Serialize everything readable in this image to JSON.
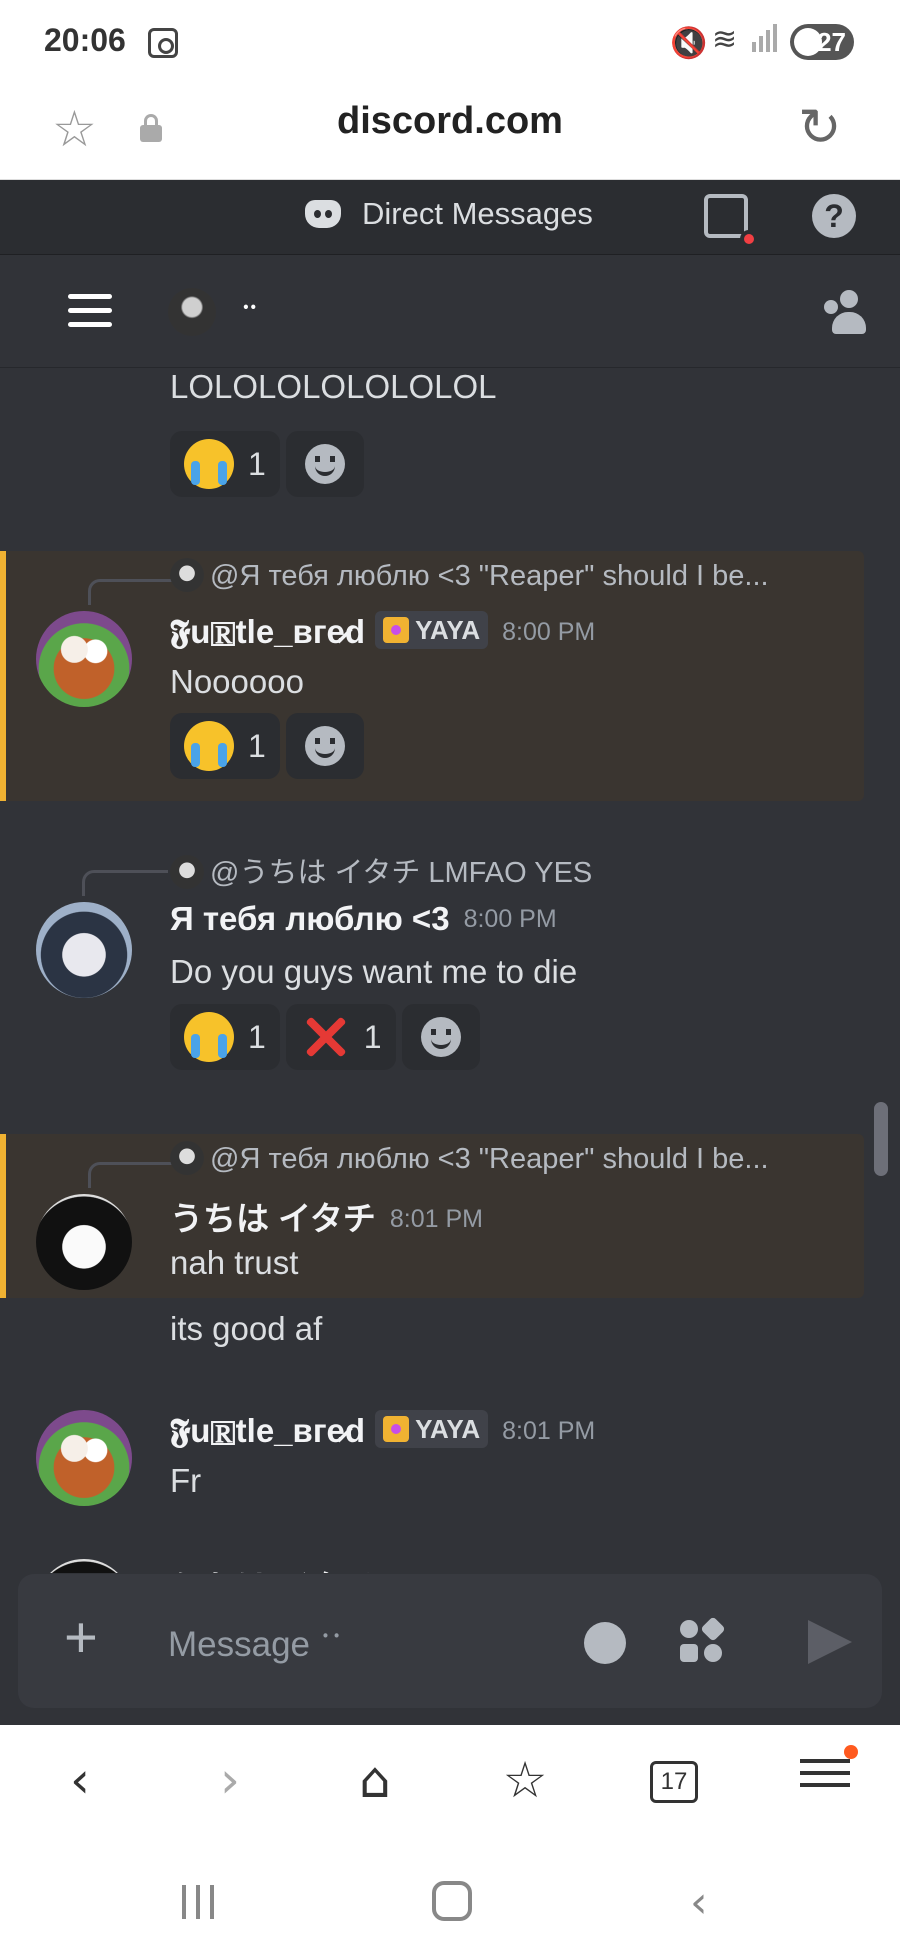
{
  "status_bar": {
    "time": "20:06",
    "battery": "27"
  },
  "browser": {
    "url": "discord.com",
    "tab_count": "17"
  },
  "discord_header": {
    "title": "Direct Messages"
  },
  "channel": {
    "name": "ॱॱ"
  },
  "messages": [
    {
      "text": "LOLOLOLOLOLOLOL",
      "reactions": [
        {
          "emoji": "loudly-crying",
          "count": "1"
        }
      ]
    },
    {
      "reply_to": "@Я тебя люблю <3 \"Reaper\" should I be...",
      "author": "𝕱u🅁tle_вгe̷d",
      "tag": "YAYA",
      "time": "8:00 PM",
      "text": "Noooooo",
      "reactions": [
        {
          "emoji": "loudly-crying",
          "count": "1"
        }
      ]
    },
    {
      "reply_to": "@うちは イタチ LMFAO YES",
      "author": "Я тебя люблю <3",
      "time": "8:00 PM",
      "text": "Do you guys want me to die",
      "reactions": [
        {
          "emoji": "loudly-crying",
          "count": "1"
        },
        {
          "emoji": "cross-mark",
          "count": "1"
        }
      ]
    },
    {
      "reply_to": "@Я тебя люблю <3 \"Reaper\" should I be...",
      "author": "うちは イタチ",
      "time": "8:01 PM",
      "text": "nah trust",
      "followup": "its good af"
    },
    {
      "author": "𝕱u🅁tle_вгe̷d",
      "tag": "YAYA",
      "time": "8:01 PM",
      "text": "Fr"
    },
    {
      "author": "うちは イタチ"
    }
  ],
  "composer": {
    "placeholder": "Message ॱॱ"
  },
  "colors": {
    "highlight_border": "#f0b232",
    "background": "#313338",
    "send_disabled": "#5c5e66",
    "notification": "#f23f43"
  }
}
